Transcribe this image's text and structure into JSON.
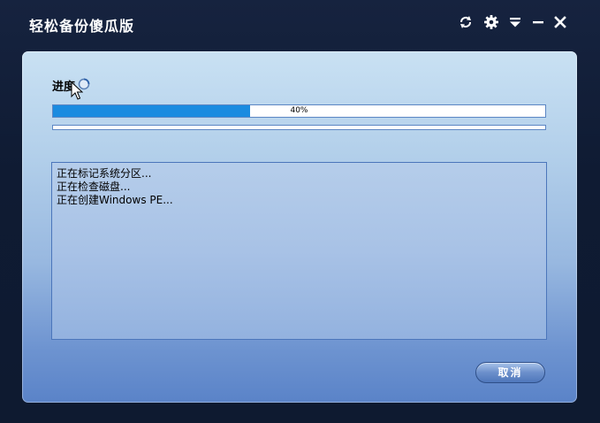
{
  "window": {
    "title": "轻松备份傻瓜版"
  },
  "titlebar_buttons": [
    {
      "name": "refresh",
      "icon": "refresh-icon"
    },
    {
      "name": "settings",
      "icon": "gear-icon"
    },
    {
      "name": "menu",
      "icon": "menu-dropdown-icon"
    },
    {
      "name": "minimize",
      "icon": "minimize-icon"
    },
    {
      "name": "close",
      "icon": "close-icon"
    }
  ],
  "progress": {
    "label": "进度",
    "value_percent": 40,
    "value_text": "40%",
    "secondary_percent": 0
  },
  "log": {
    "lines": [
      "正在标记系统分区...",
      "正在检查磁盘...",
      "正在创建Windows PE..."
    ]
  },
  "actions": {
    "cancel_label": "取消"
  },
  "colors": {
    "progress_fill": "#1a8be0",
    "title_text": "#ffffff"
  }
}
